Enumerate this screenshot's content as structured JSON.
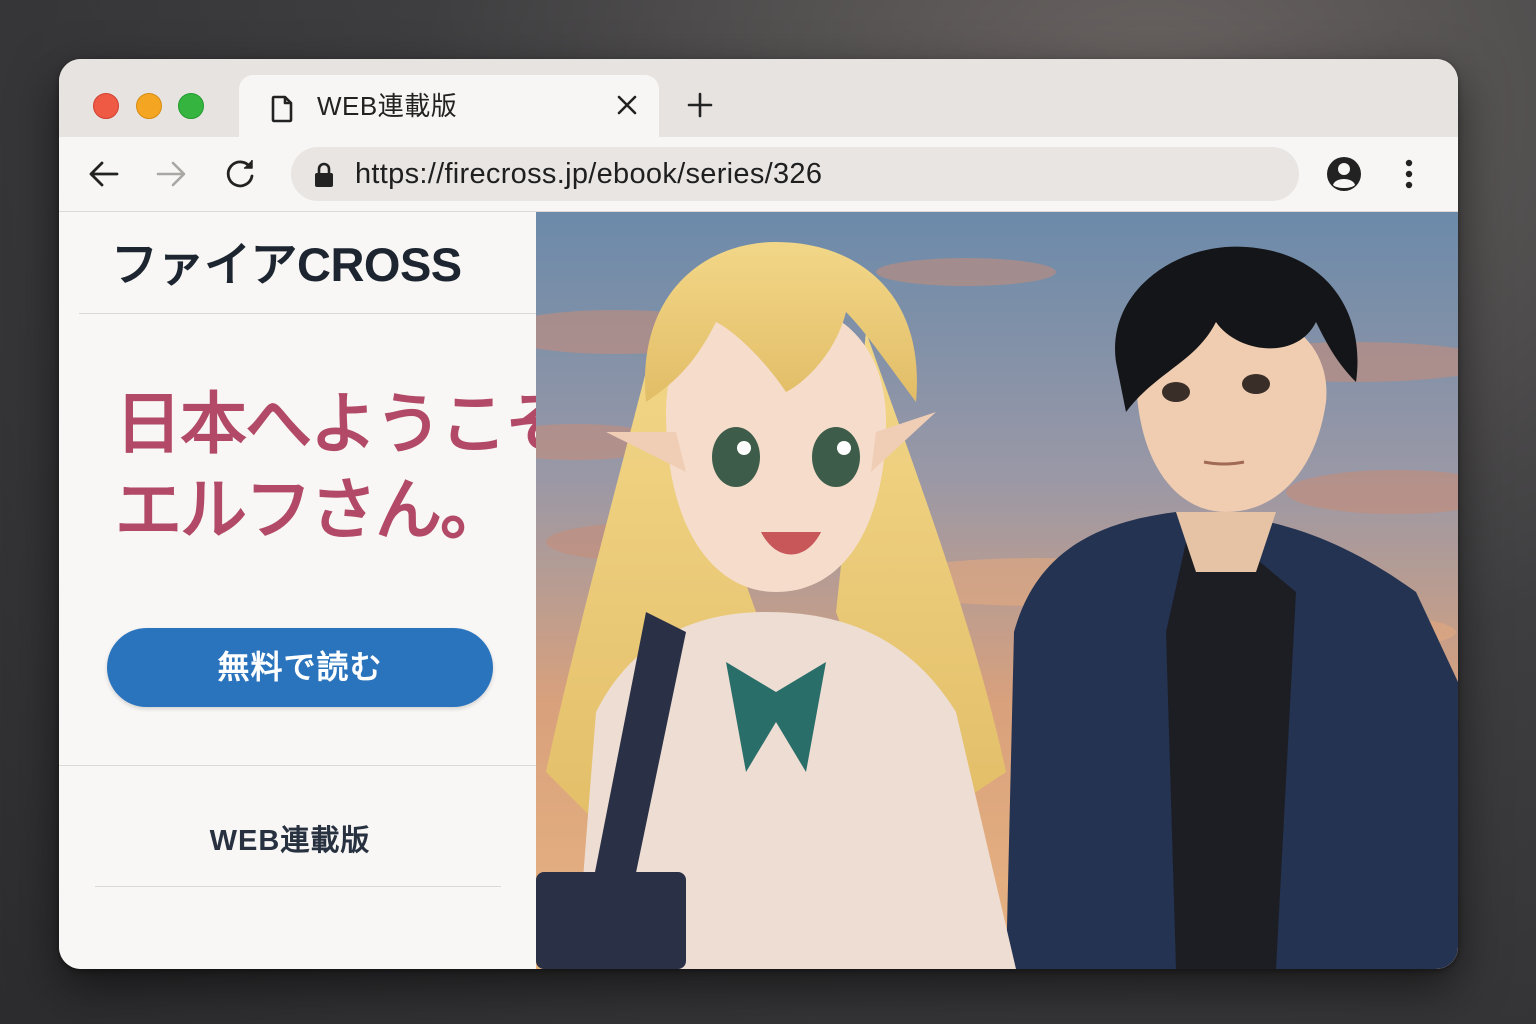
{
  "browser": {
    "tab": {
      "title": "WEB連載版"
    },
    "url": "https://firecross.jp/ebook/series/326"
  },
  "sidebar": {
    "logo": "ファイアCROSS",
    "title_line1": "日本へようこそ",
    "title_line2": "エルフさん。",
    "read_button": "無料で読む",
    "web_link": "WEB連載版"
  },
  "colors": {
    "title": "#b24a67",
    "button": "#2a74bd"
  }
}
